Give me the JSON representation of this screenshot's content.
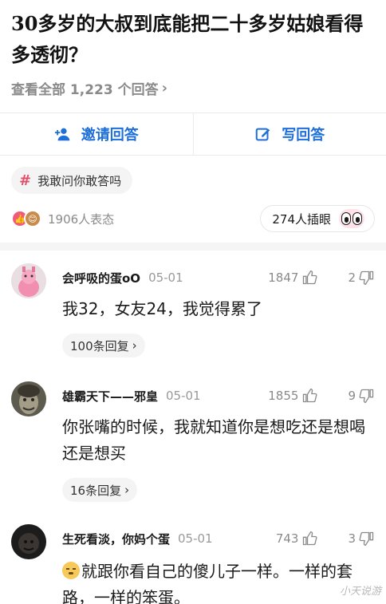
{
  "question": {
    "title": "30多岁的大叔到底能把二十多岁姑娘看得多透彻？",
    "view_all": "查看全部 1,223 个回答"
  },
  "actions": {
    "invite_label": "邀请回答",
    "write_label": "写回答"
  },
  "topic_tag": "我敢问你敢答吗",
  "reactions": {
    "count_label": "1906人表态",
    "poke_label": "274人插眼"
  },
  "comments": [
    {
      "user": "会呼吸的蛋oO",
      "date": "05-01",
      "likes": "1847",
      "dislikes": "2",
      "text": "我32，女友24，我觉得累了",
      "replies": "100条回复"
    },
    {
      "user": "雄霸天下——邪皇",
      "date": "05-01",
      "likes": "1855",
      "dislikes": "9",
      "text": "你张嘴的时候，我就知道你是想吃还是想喝还是想买",
      "replies": "16条回复"
    },
    {
      "user": "生死看淡，你妈个蛋",
      "date": "05-01",
      "likes": "743",
      "dislikes": "3",
      "text": "就跟你看自己的傻儿子一样。一样的套路，一样的笨蛋。"
    }
  ],
  "watermark": "小天说游",
  "colors": {
    "accent_blue": "#1e6fd9",
    "tag_pink": "#e0506b",
    "muted_gray": "#8a8a8a"
  }
}
